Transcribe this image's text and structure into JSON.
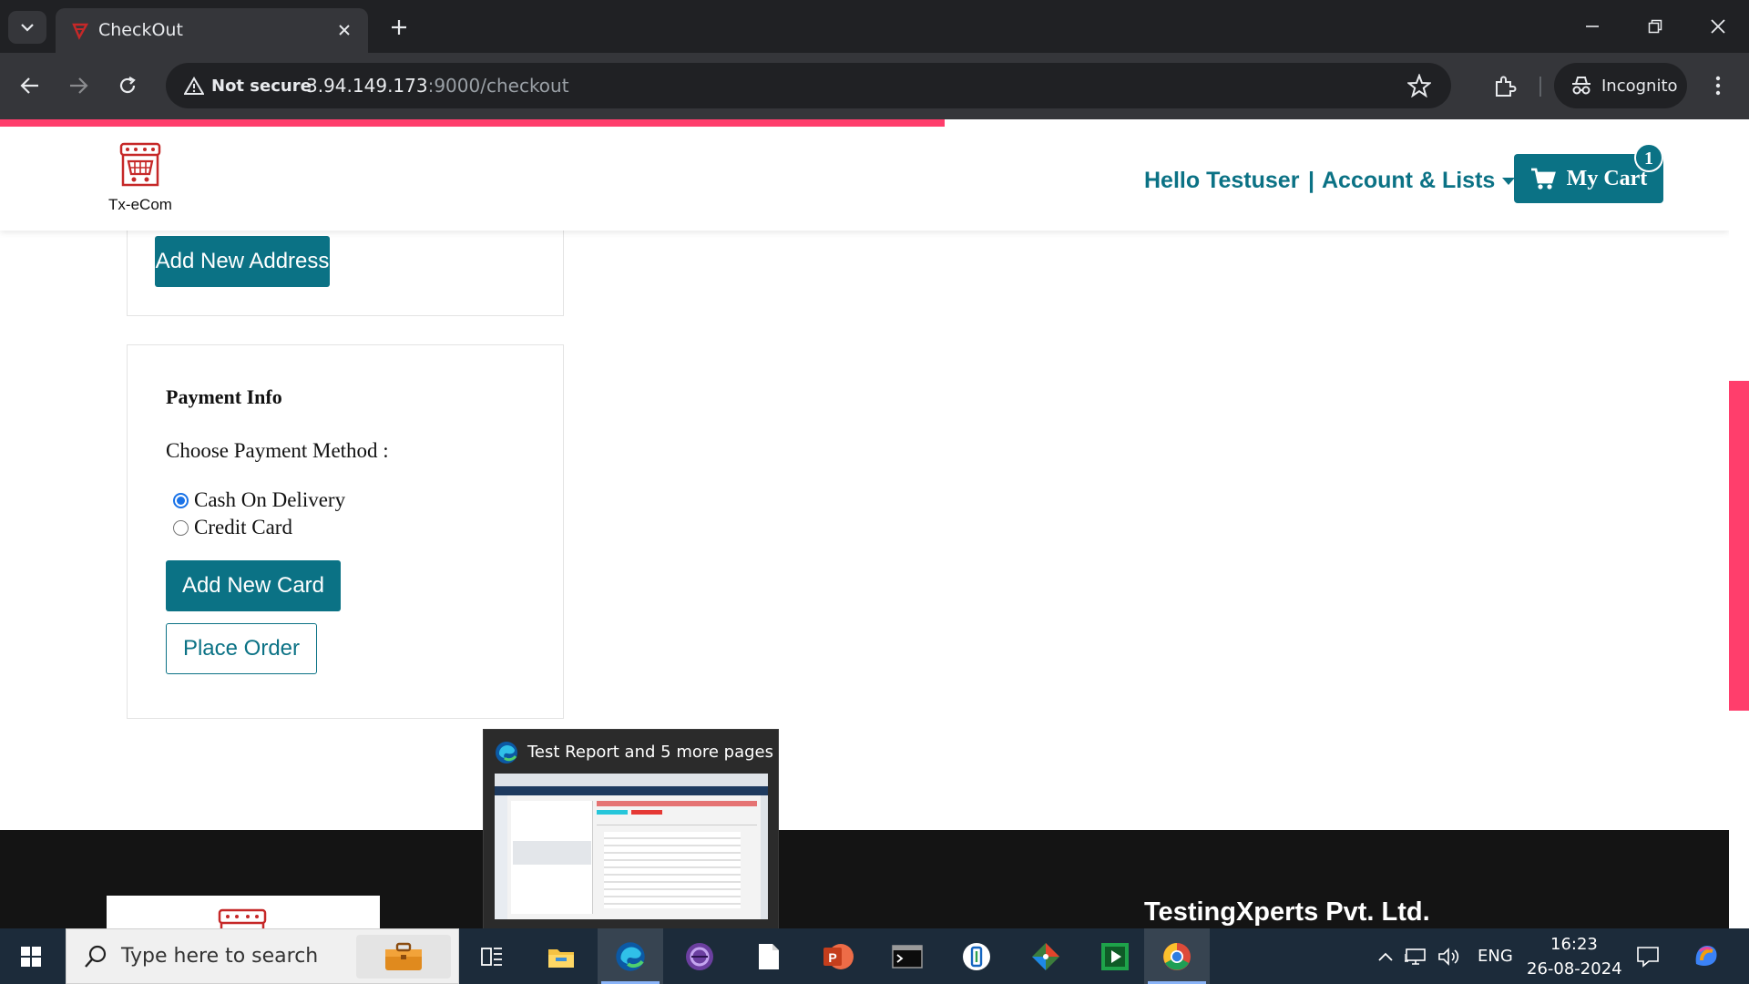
{
  "browser": {
    "tab_title": "CheckOut",
    "security_label": "Not secure",
    "url_host": "3.94.149.173",
    "url_path": ":9000/checkout",
    "profile_label": "Incognito",
    "load_progress": 0.54
  },
  "header": {
    "brand_name": "Tx-eCom",
    "greeting": "Hello Testuser",
    "separator": "|",
    "account_label": "Account & Lists",
    "cart_label": "My Cart",
    "cart_count": "1"
  },
  "address": {
    "add_button": "Add New Address"
  },
  "payment": {
    "title": "Payment Info",
    "method_label": "Choose Payment Method :",
    "options": [
      {
        "label": "Cash On Delivery",
        "checked": true
      },
      {
        "label": "Credit Card",
        "checked": false
      }
    ],
    "add_card_button": "Add New Card",
    "place_order_button": "Place Order"
  },
  "footer": {
    "company": "TestingXperts Pvt. Ltd."
  },
  "thumbnail_popup": {
    "title": "Test Report and 5 more pages -..."
  },
  "taskbar": {
    "search_placeholder": "Type here to search",
    "language": "ENG",
    "time": "16:23",
    "date": "26-08-2024"
  },
  "colors": {
    "accent": "#0b7285",
    "progress": "#ff3e6c",
    "chrome_dark": "#202124",
    "chrome_mid": "#35363a",
    "footer_bg": "#141414"
  }
}
